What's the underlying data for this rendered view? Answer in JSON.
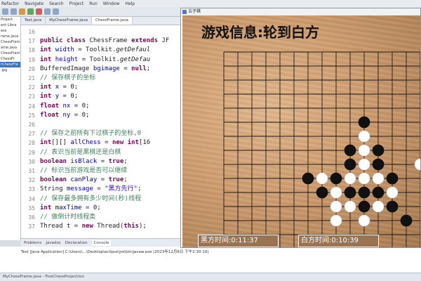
{
  "menu": [
    "Refactor",
    "Navigate",
    "Search",
    "Project",
    "Run",
    "Window",
    "Help"
  ],
  "explorer": {
    "items": [
      "Project",
      "ent Libra",
      "ess",
      "rame.java",
      "ChessFram",
      "ame.java",
      "ChessFram",
      "ChessFr",
      "rChessFra",
      ".jpg"
    ],
    "selected_index": 8
  },
  "editor": {
    "tabs": [
      "Test.java",
      "MyChessFrame.java",
      "ChessFrame.java"
    ],
    "active_tab": 2,
    "lines": [
      {
        "n": "16",
        "html": ""
      },
      {
        "n": "17",
        "html": "<span class='kw'>public class</span> ChessFrame <span class='kw'>extends</span> JF"
      },
      {
        "n": "18",
        "html": "  <span class='kw'>int</span> <span class='fld'>width</span> = Toolkit.<span class='it'>getDefaul</span>"
      },
      {
        "n": "19",
        "html": "  <span class='kw'>int</span> <span class='fld'>height</span> = Toolkit.<span class='it'>getDefau</span>"
      },
      {
        "n": "20",
        "html": "  BufferedImage <span class='fld'>bgimage</span> = <span class='kw'>null</span>;"
      },
      {
        "n": "21",
        "html": "  <span class='cm'>// 保存棋子的坐标</span>"
      },
      {
        "n": "22",
        "html": "  <span class='kw'>int</span> <span class='fld'>x</span> = 0;"
      },
      {
        "n": "23",
        "html": "  <span class='kw'>int</span> <span class='fld'>y</span> = 0;"
      },
      {
        "n": "24",
        "html": "  <span class='kw'>float</span> <span class='fld'>nx</span> = 0;"
      },
      {
        "n": "25",
        "html": "  <span class='kw'>float</span> <span class='fld'>ny</span> = 0;"
      },
      {
        "n": "26",
        "html": ""
      },
      {
        "n": "27",
        "html": "  <span class='cm'>// 保存之前所有下过棋子的坐标,0</span>"
      },
      {
        "n": "28",
        "html": "  <span class='kw'>int</span>[][] <span class='fld'>allChess</span> = <span class='kw'>new int</span>[16"
      },
      {
        "n": "29",
        "html": "  <span class='cm'>// 表识当前是黑棋还是白棋</span>"
      },
      {
        "n": "30",
        "html": "  <span class='kw'>boolean</span> <span class='fld'>isBlack</span> = <span class='kw'>true</span>;"
      },
      {
        "n": "31",
        "html": "  <span class='cm'>// 标识当前游戏是否可以继续</span>"
      },
      {
        "n": "32",
        "html": "  <span class='kw'>boolean</span> <span class='fld'>canPlay</span> = <span class='kw'>true</span>;"
      },
      {
        "n": "33",
        "html": "  String <span class='fld'>message</span> = <span class='st'>\"黑方先行\"</span>;"
      },
      {
        "n": "34",
        "html": "  <span class='cm'>// 保存最多拥有多少时间(秒)线程</span>"
      },
      {
        "n": "35",
        "html": "  <span class='kw'>int</span> <span class='fld'>maxTime</span> = 0;"
      },
      {
        "n": "36",
        "html": "  <span class='cm'>// 做倒计时线程类</span>"
      },
      {
        "n": "37",
        "html": "  Thread <span class='fld'>t</span> = <span class='kw'>new</span> Thread(<span class='kw'>this</span>);"
      }
    ]
  },
  "views": {
    "tabs": [
      "Problems",
      "Javadoc",
      "Declaration",
      "Console"
    ],
    "active": 3
  },
  "console": {
    "line1": "Test [Java Application] C:\\Users\\...\\Desktop\\eclipse\\jre\\bin\\javaw.exe (2023年12月6日 下午2:30:10)"
  },
  "statusbar": {
    "text": "MyChessFrame.java - FiveChessProject/src"
  },
  "game": {
    "window_title": "五子棋",
    "info": "游戏信息:轮到白方",
    "black_timer": "黑方时间:0:11:37",
    "white_timer": "白方时间:0:10:39",
    "grid": {
      "cols": 19,
      "rows": 19
    },
    "colors": {
      "black": "#111111",
      "white": "#ffffff",
      "line": "#1a1a1a"
    },
    "stones": [
      {
        "c": 6,
        "r": 4,
        "color": "black"
      },
      {
        "c": 6,
        "r": 5,
        "color": "white"
      },
      {
        "c": 5,
        "r": 6,
        "color": "black"
      },
      {
        "c": 6,
        "r": 6,
        "color": "white"
      },
      {
        "c": 7,
        "r": 6,
        "color": "black"
      },
      {
        "c": 5,
        "r": 7,
        "color": "black"
      },
      {
        "c": 6,
        "r": 7,
        "color": "white"
      },
      {
        "c": 7,
        "r": 7,
        "color": "black"
      },
      {
        "c": 10,
        "r": 7,
        "color": "white"
      },
      {
        "c": 2,
        "r": 8,
        "color": "black"
      },
      {
        "c": 3,
        "r": 8,
        "color": "white"
      },
      {
        "c": 4,
        "r": 8,
        "color": "black"
      },
      {
        "c": 5,
        "r": 8,
        "color": "white"
      },
      {
        "c": 6,
        "r": 8,
        "color": "white"
      },
      {
        "c": 7,
        "r": 8,
        "color": "white"
      },
      {
        "c": 8,
        "r": 8,
        "color": "black"
      },
      {
        "c": 3,
        "r": 9,
        "color": "black"
      },
      {
        "c": 4,
        "r": 9,
        "color": "white"
      },
      {
        "c": 5,
        "r": 9,
        "color": "black"
      },
      {
        "c": 6,
        "r": 9,
        "color": "black"
      },
      {
        "c": 7,
        "r": 9,
        "color": "black"
      },
      {
        "c": 8,
        "r": 9,
        "color": "white"
      },
      {
        "c": 4,
        "r": 10,
        "color": "white"
      },
      {
        "c": 5,
        "r": 10,
        "color": "white"
      },
      {
        "c": 6,
        "r": 10,
        "color": "black"
      },
      {
        "c": 7,
        "r": 10,
        "color": "white"
      },
      {
        "c": 8,
        "r": 10,
        "color": "black"
      },
      {
        "c": 4,
        "r": 11,
        "color": "white"
      },
      {
        "c": 6,
        "r": 11,
        "color": "white"
      },
      {
        "c": 9,
        "r": 11,
        "color": "black"
      }
    ]
  }
}
